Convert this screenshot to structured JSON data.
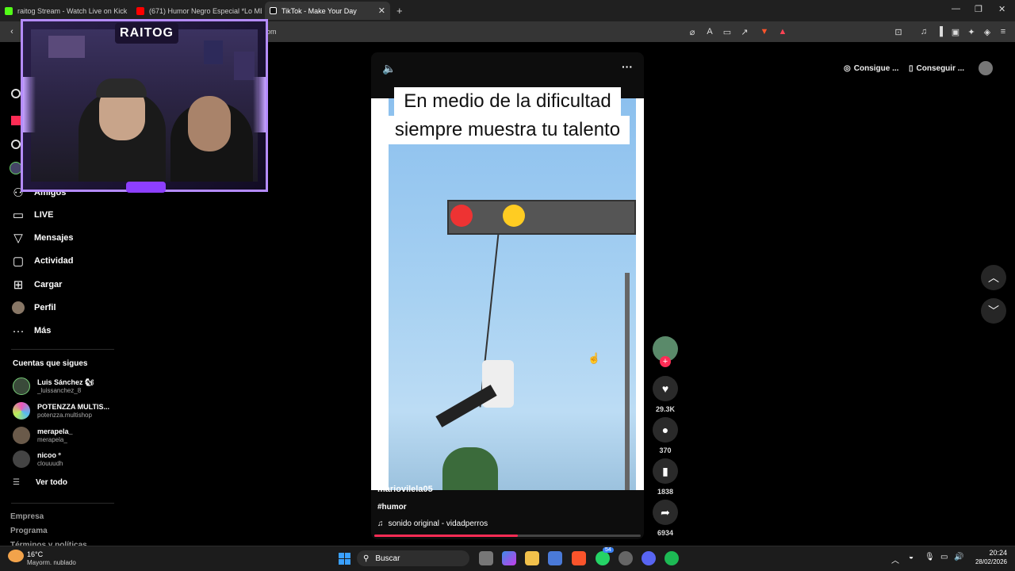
{
  "browser": {
    "tabs": [
      {
        "title": "raitog Stream - Watch Live on Kick",
        "favicon_color": "#53fc18"
      },
      {
        "title": "(671) Humor Negro Especial *Lo ME",
        "favicon_color": "#ff0000"
      },
      {
        "title": "TikTok - Make Your Day",
        "favicon_color": "#ffffff"
      }
    ],
    "new_tab_icon": "plus-icon",
    "address_visible": "om"
  },
  "sidebar": {
    "nav": [
      {
        "label": "Amigos",
        "icon": "friends-icon"
      },
      {
        "label": "LIVE",
        "icon": "live-icon"
      },
      {
        "label": "Mensajes",
        "icon": "messages-icon"
      },
      {
        "label": "Actividad",
        "icon": "activity-icon"
      },
      {
        "label": "Cargar",
        "icon": "upload-icon"
      },
      {
        "label": "Perfil",
        "icon": "profile-icon"
      },
      {
        "label": "Más",
        "icon": "more-icon"
      }
    ],
    "following_title": "Cuentas que sigues",
    "accounts": [
      {
        "name": "Luis Sánchez 🐿",
        "handle": "_luissanchez_8"
      },
      {
        "name": "POTENZZA MULTIS...",
        "handle": "potenzza.multishop"
      },
      {
        "name": "merapela_",
        "handle": "merapela_"
      },
      {
        "name": "nicoo º",
        "handle": "clouuudh"
      }
    ],
    "see_all": "Ver todo",
    "footer": [
      "Empresa",
      "Programa",
      "Términos y políticas"
    ]
  },
  "overlay": {
    "logo_text": "RAITOG"
  },
  "video": {
    "caption_lines": [
      "En medio de la dificultad",
      "siempre muestra tu talento"
    ],
    "author": "mariovilela05",
    "hashtag": "#humor",
    "sound": "sonido original - vidadperros",
    "progress": 0.54
  },
  "actions": {
    "likes": "29.3K",
    "comments": "370",
    "saves": "1838",
    "shares": "6934"
  },
  "header_pills": {
    "coins": "Consigue ...",
    "app": "Conseguir ..."
  },
  "taskbar": {
    "weather_temp": "16°C",
    "weather_desc": "Mayorm. nublado",
    "search": "Buscar",
    "time": "20:24",
    "date": "28/02/2026",
    "whatsapp_badge": "54"
  }
}
